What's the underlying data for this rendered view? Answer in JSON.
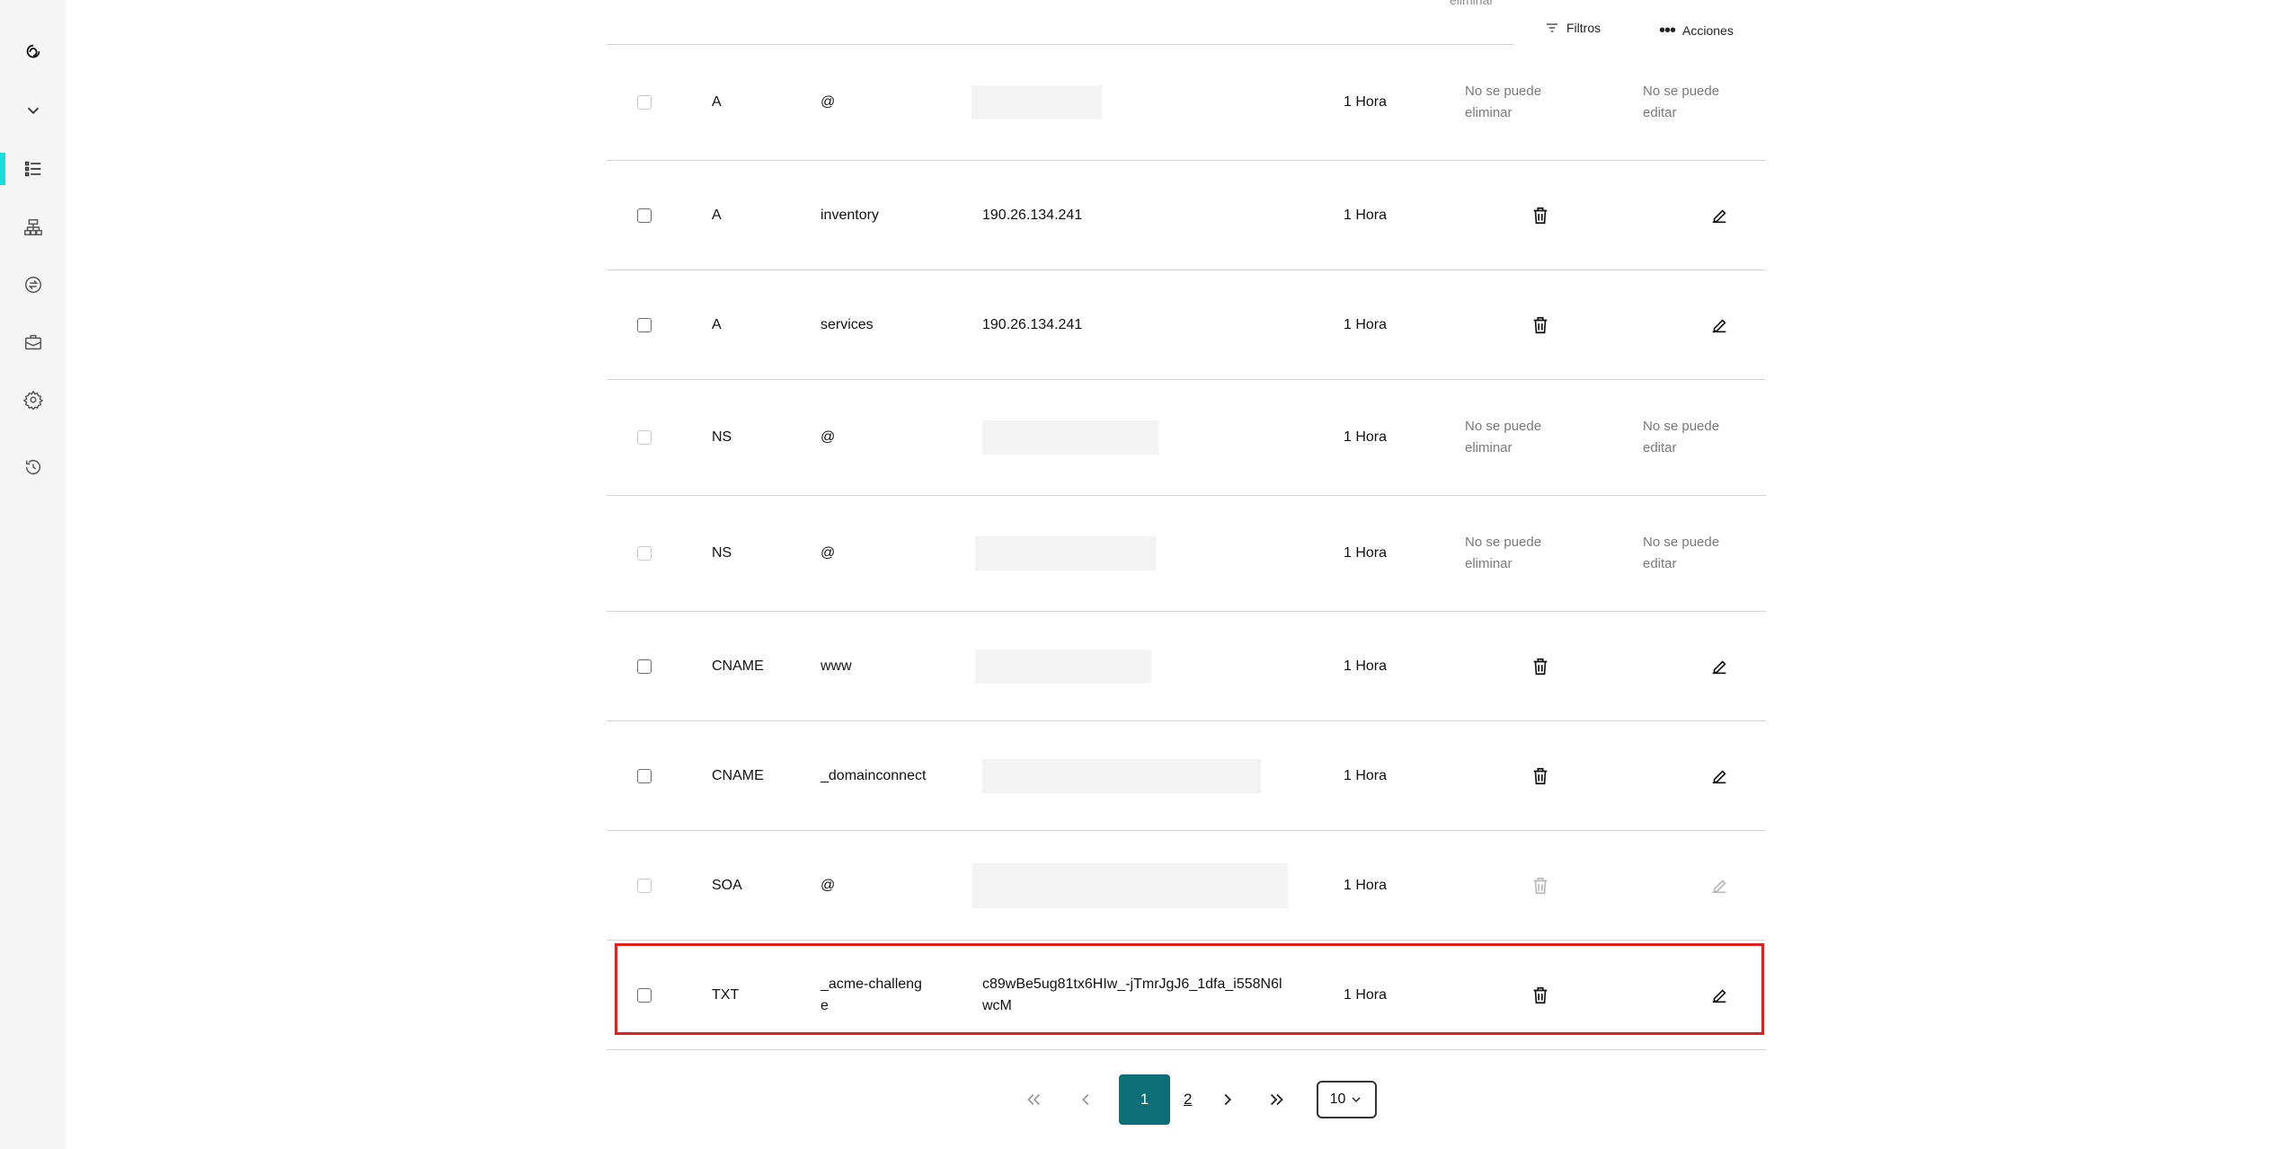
{
  "toolbar": {
    "faded_text": "eliminar",
    "filters_label": "Filtros",
    "actions_label": "Acciones"
  },
  "sidebar": {
    "items": [
      {
        "icon": "godaddy-logo-icon"
      },
      {
        "icon": "chevron-down-icon"
      },
      {
        "icon": "dns-list-icon",
        "active": true
      },
      {
        "icon": "sitemap-icon"
      },
      {
        "icon": "transfer-icon"
      },
      {
        "icon": "briefcase-icon"
      },
      {
        "icon": "gear-icon"
      },
      {
        "icon": "history-icon"
      }
    ]
  },
  "records": [
    {
      "type": "A",
      "name": "@",
      "value": "",
      "ttl": "1 Hora",
      "delete_text": "No se puede eliminar",
      "edit_text": "No se puede editar",
      "checkbox_disabled": true
    },
    {
      "type": "A",
      "name": "inventory",
      "value": "190.26.134.241",
      "ttl": "1 Hora"
    },
    {
      "type": "A",
      "name": "services",
      "value": "190.26.134.241",
      "ttl": "1 Hora"
    },
    {
      "type": "NS",
      "name": "@",
      "value": "",
      "ttl": "1 Hora",
      "delete_text": "No se puede eliminar",
      "edit_text": "No se puede editar",
      "checkbox_disabled": true
    },
    {
      "type": "NS",
      "name": "@",
      "value": "",
      "ttl": "1 Hora",
      "delete_text": "No se puede eliminar",
      "edit_text": "No se puede editar",
      "checkbox_disabled": true
    },
    {
      "type": "CNAME",
      "name": "www",
      "value": "",
      "ttl": "1 Hora"
    },
    {
      "type": "CNAME",
      "name": "_domainconnect",
      "value": "",
      "ttl": "1 Hora"
    },
    {
      "type": "SOA",
      "name": "@",
      "value": "",
      "ttl": "1 Hora",
      "icons_disabled": true,
      "checkbox_disabled": true
    },
    {
      "type": "TXT",
      "name": "_acme-challenge",
      "value": "c89wBe5ug81tx6HIw_-jTmrJgJ6_1dfa_i558N6lwcM",
      "ttl": "1 Hora",
      "highlighted": true
    }
  ],
  "pagination": {
    "current_page": "1",
    "next_page": "2",
    "page_size": "10"
  },
  "colors": {
    "accent": "#1bdbdb",
    "primary": "#0c6f77",
    "highlight_border": "#e0201f"
  }
}
